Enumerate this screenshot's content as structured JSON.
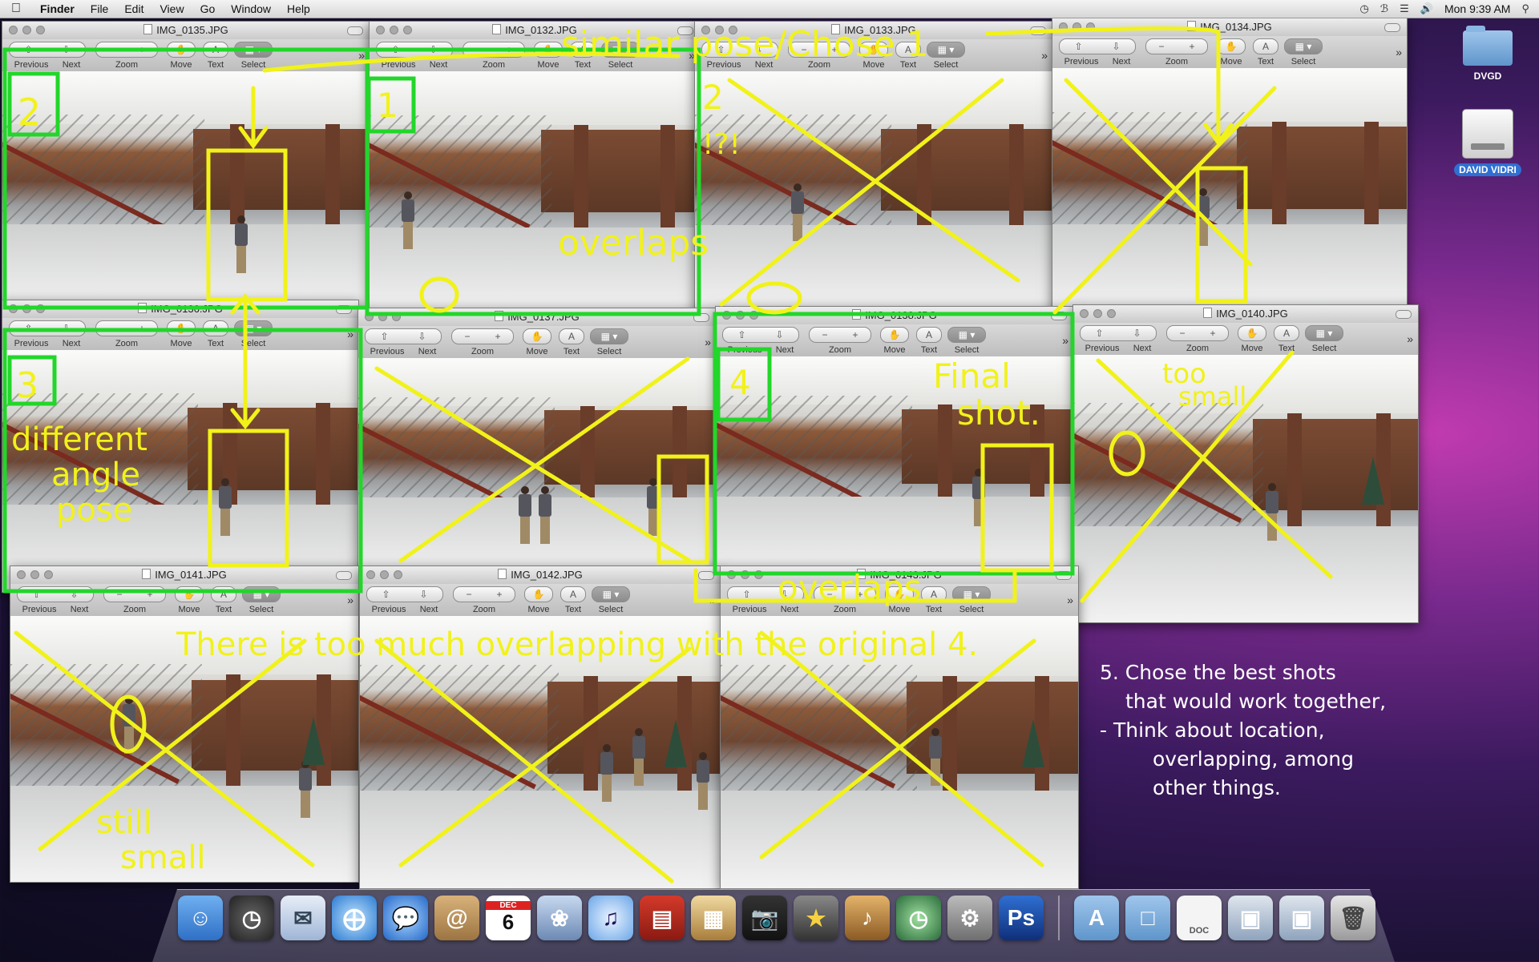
{
  "menubar": {
    "app": "Finder",
    "items": [
      "File",
      "Edit",
      "View",
      "Go",
      "Window",
      "Help"
    ],
    "clock": "Mon 9:39 AM"
  },
  "toolbar_labels": {
    "previous": "Previous",
    "next": "Next",
    "zoom": "Zoom",
    "move": "Move",
    "text": "Text",
    "select": "Select"
  },
  "windows": [
    {
      "title": "IMG_0135.JPG"
    },
    {
      "title": "IMG_0132.JPG"
    },
    {
      "title": "IMG_0133.JPG"
    },
    {
      "title": "IMG_0134.JPG"
    },
    {
      "title": "IMG_0136.JPG"
    },
    {
      "title": "IMG_0137.JPG"
    },
    {
      "title": "IMG_0138.JPG"
    },
    {
      "title": "IMG_0140.JPG"
    },
    {
      "title": "IMG_0141.JPG"
    },
    {
      "title": "IMG_0142.JPG"
    },
    {
      "title": "IMG_0143.JPG"
    }
  ],
  "desktop_icons": [
    {
      "label": "DVGD"
    },
    {
      "label": "DAVID VIDRI"
    }
  ],
  "annotations": {
    "similar_pose": "similar pose/Chose 1",
    "n1": "1",
    "n2": "2",
    "n2q": "2",
    "qmark": "!?!",
    "n3": "3",
    "n4": "4",
    "overlaps_top": "overlaps",
    "different_1": "different",
    "different_2": "angle",
    "different_3": "pose",
    "final_1": "Final",
    "final_2": "shot.",
    "too_small_1": "too",
    "too_small_2": "small",
    "overlaps_bottom": "overlaps",
    "too_much": "There is too much overlapping with the original 4.",
    "still_1": "still",
    "still_2": "small"
  },
  "instructions": [
    "5. Chose the best shots",
    "that would work together,",
    "- Think about location,",
    "overlapping, among",
    "other things."
  ],
  "dock": {
    "calendar_month": "DEC",
    "calendar_day": "6",
    "photoshop": "Ps",
    "doc_label": "DOC"
  },
  "colors": {
    "annotation_yellow": "#f1f21a",
    "annotation_green": "#22d62a",
    "desktop_purple": "#7a2a8e"
  }
}
